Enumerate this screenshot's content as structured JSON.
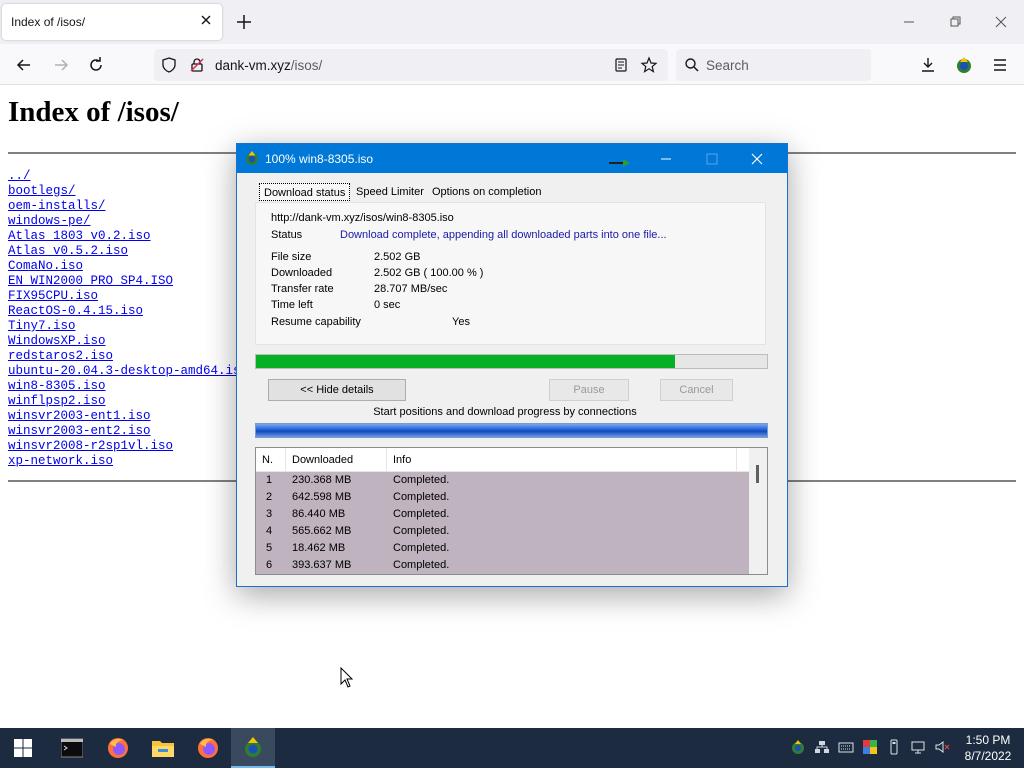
{
  "browser": {
    "tab_title": "Index of /isos/",
    "url_host": "dank-vm.xyz",
    "url_path": "/isos/",
    "search_placeholder": "Search"
  },
  "page": {
    "heading": "Index of /isos/",
    "files": [
      "../",
      "bootlegs/",
      "oem-installs/",
      "windows-pe/",
      "Atlas_1803_v0.2.iso",
      "Atlas_v0.5.2.iso",
      "ComaNo.iso",
      "EN_WIN2000_PRO_SP4.ISO",
      "FIX95CPU.iso",
      "ReactOS-0.4.15.iso",
      "Tiny7.iso",
      "WindowsXP.iso",
      "redstaros2.iso",
      "ubuntu-20.04.3-desktop-amd64.iso",
      "win8-8305.iso",
      "winflpsp2.iso",
      "winsvr2003-ent1.iso",
      "winsvr2003-ent2.iso",
      "winsvr2008-r2sp1vl.iso",
      "xp-network.iso"
    ]
  },
  "dialog": {
    "title": "100% win8-8305.iso",
    "tabs": [
      "Download status",
      "Speed Limiter",
      "Options on completion"
    ],
    "url": "http://dank-vm.xyz/isos/win8-8305.iso",
    "status_label": "Status",
    "status_value": "Download complete, appending all downloaded parts into one file...",
    "file_size_label": "File size",
    "file_size_value": "2.502  GB",
    "downloaded_label": "Downloaded",
    "downloaded_value": "2.502  GB  ( 100.00 % )",
    "transfer_rate_label": "Transfer rate",
    "transfer_rate_value": "28.707  MB/sec",
    "time_left_label": "Time left",
    "time_left_value": "0 sec",
    "resume_label": "Resume capability",
    "resume_value": "Yes",
    "progress_fraction": 0.82,
    "hide_details_label": "<< Hide details",
    "pause_label": "Pause",
    "cancel_label": "Cancel",
    "connections_caption": "Start positions and download progress by connections",
    "columns": [
      "N.",
      "Downloaded",
      "Info"
    ],
    "connections": [
      {
        "n": "1",
        "downloaded": "230.368  MB",
        "info": "Completed."
      },
      {
        "n": "2",
        "downloaded": "642.598  MB",
        "info": "Completed."
      },
      {
        "n": "3",
        "downloaded": "86.440  MB",
        "info": "Completed."
      },
      {
        "n": "4",
        "downloaded": "565.662  MB",
        "info": "Completed."
      },
      {
        "n": "5",
        "downloaded": "18.462  MB",
        "info": "Completed."
      },
      {
        "n": "6",
        "downloaded": "393.637  MB",
        "info": "Completed."
      }
    ]
  },
  "taskbar": {
    "time": "1:50 PM",
    "date": "8/7/2022"
  },
  "colors": {
    "titlebar": "#0078d7",
    "progress_green": "#06b025",
    "link": "#0000ee",
    "taskbar": "#1c2b3f",
    "connection_rows": "#beb3bf"
  }
}
